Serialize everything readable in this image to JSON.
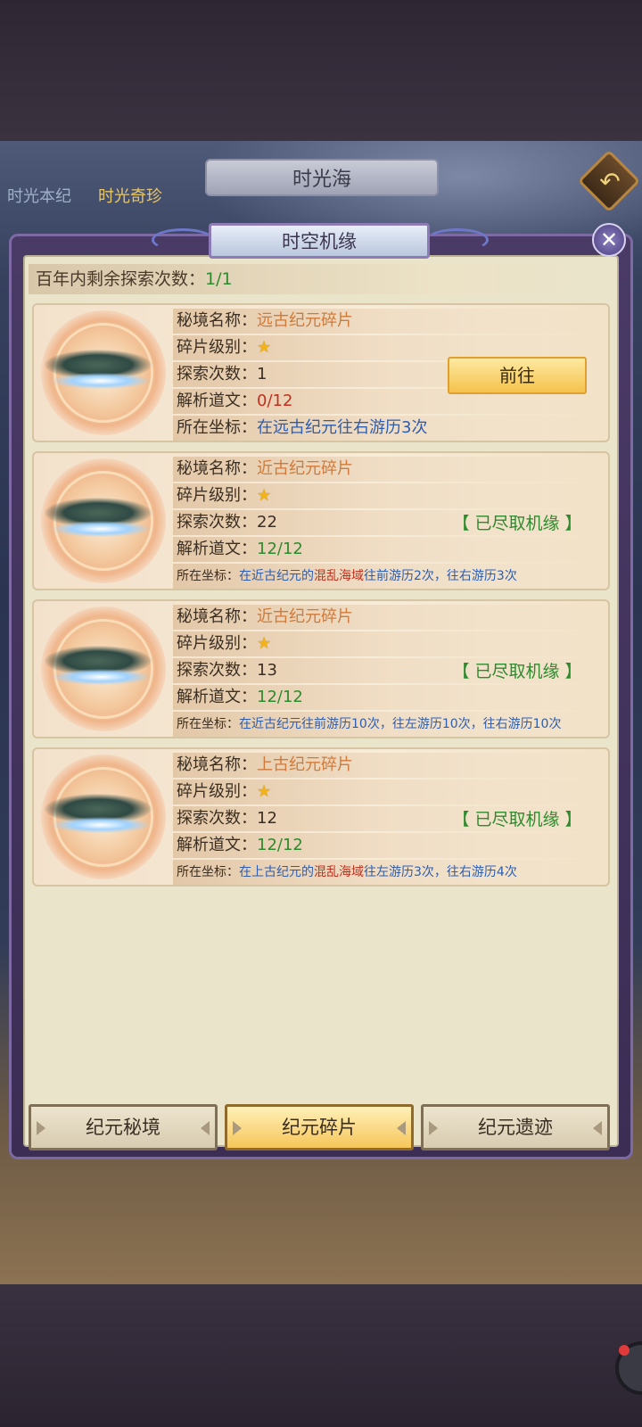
{
  "background": {
    "title": "时光海",
    "tabs": [
      "时光本纪",
      "时光奇珍"
    ]
  },
  "modal": {
    "title": "时空机缘",
    "remaining_label": "百年内剩余探索次数：",
    "remaining_value": "1/1",
    "labels": {
      "name": "秘境名称：",
      "level": "碎片级别：",
      "count": "探索次数：",
      "decode": "解析道文：",
      "coords": "所在坐标："
    },
    "go_label": "前往",
    "exhausted_label": "【 已尽取机缘 】",
    "cards": [
      {
        "name": "远古纪元碎片",
        "stars": 1,
        "count": "1",
        "decode": "0/12",
        "coords": [
          {
            "t": "在远古纪元往右游历3次"
          }
        ],
        "status": "go"
      },
      {
        "name": "近古纪元碎片",
        "stars": 1,
        "count": "22",
        "decode": "12/12",
        "coords": [
          {
            "t": "在近古纪元的"
          },
          {
            "t": "混乱海域",
            "region": true
          },
          {
            "t": "往前游历2次，往右游历3次"
          }
        ],
        "status": "exhausted"
      },
      {
        "name": "近古纪元碎片",
        "stars": 1,
        "count": "13",
        "decode": "12/12",
        "coords": [
          {
            "t": "在近古纪元往前游历10次，往左游历10次，往右游历10次"
          }
        ],
        "status": "exhausted"
      },
      {
        "name": "上古纪元碎片",
        "stars": 1,
        "count": "12",
        "decode": "12/12",
        "coords": [
          {
            "t": "在上古纪元的"
          },
          {
            "t": "混乱海域",
            "region": true
          },
          {
            "t": "往左游历3次，往右游历4次"
          }
        ],
        "status": "exhausted"
      }
    ],
    "bottom_tabs": [
      {
        "label": "纪元秘境",
        "active": false
      },
      {
        "label": "纪元碎片",
        "active": true
      },
      {
        "label": "纪元遗迹",
        "active": false
      }
    ]
  },
  "colors": {
    "accent_gold": "#f5c24c",
    "exhausted_green": "#2e8a2e",
    "progress_red": "#c0301e",
    "coords_blue": "#2d5db0",
    "name_orange": "#d07a3a"
  }
}
